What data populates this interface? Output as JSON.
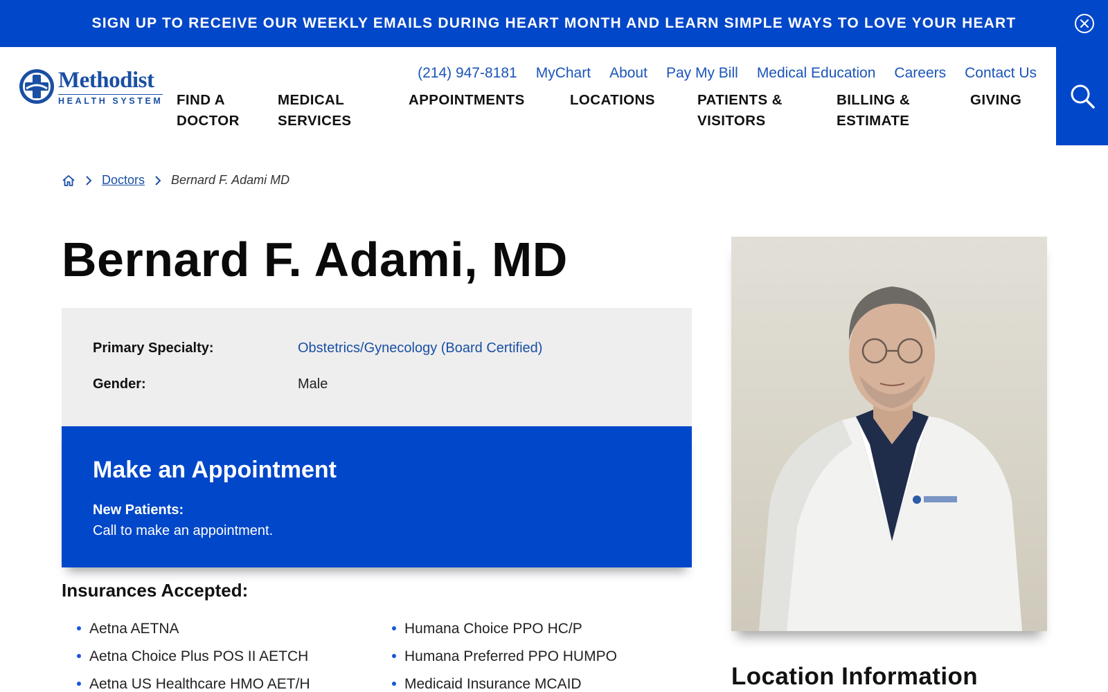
{
  "banner": {
    "text": "SIGN UP TO RECEIVE OUR WEEKLY EMAILS DURING HEART MONTH AND LEARN SIMPLE WAYS TO LOVE YOUR HEART",
    "close_icon": "close-circle-icon"
  },
  "logo": {
    "name": "Methodist",
    "sub": "HEALTH SYSTEM"
  },
  "utility_nav": [
    "(214) 947-8181",
    "MyChart",
    "About",
    "Pay My Bill",
    "Medical Education",
    "Careers",
    "Contact Us"
  ],
  "main_nav": [
    {
      "line1": "FIND A",
      "line2": "DOCTOR"
    },
    {
      "line1": "MEDICAL",
      "line2": "SERVICES"
    },
    {
      "line1": "APPOINTMENTS",
      "line2": ""
    },
    {
      "line1": "LOCATIONS",
      "line2": ""
    },
    {
      "line1": "PATIENTS &",
      "line2": "VISITORS"
    },
    {
      "line1": "BILLING &",
      "line2": "ESTIMATE"
    },
    {
      "line1": "GIVING",
      "line2": ""
    }
  ],
  "search": {
    "icon": "search-icon"
  },
  "breadcrumb": {
    "home_icon": "home-icon",
    "doctors": "Doctors",
    "current": "Bernard F. Adami MD"
  },
  "doctor": {
    "name": "Bernard F. Adami, MD",
    "specialty_label": "Primary Specialty:",
    "specialty_value": "Obstetrics/Gynecology (Board Certified)",
    "gender_label": "Gender:",
    "gender_value": "Male"
  },
  "appointment": {
    "title": "Make an Appointment",
    "new_patients_label": "New Patients:",
    "new_patients_text": "Call to make an appointment."
  },
  "insurances": {
    "heading": "Insurances Accepted:",
    "col1": [
      "Aetna AETNA",
      "Aetna Choice Plus POS II AETCH",
      "Aetna US Healthcare HMO AET/H"
    ],
    "col2": [
      "Humana Choice PPO HC/P",
      "Humana Preferred PPO HUMPO",
      "Medicaid Insurance MCAID"
    ]
  },
  "location": {
    "heading": "Location Information"
  },
  "colors": {
    "brand_blue": "#0047c9",
    "link_blue": "#1a4fa3",
    "card_gray": "#eeeeee"
  }
}
